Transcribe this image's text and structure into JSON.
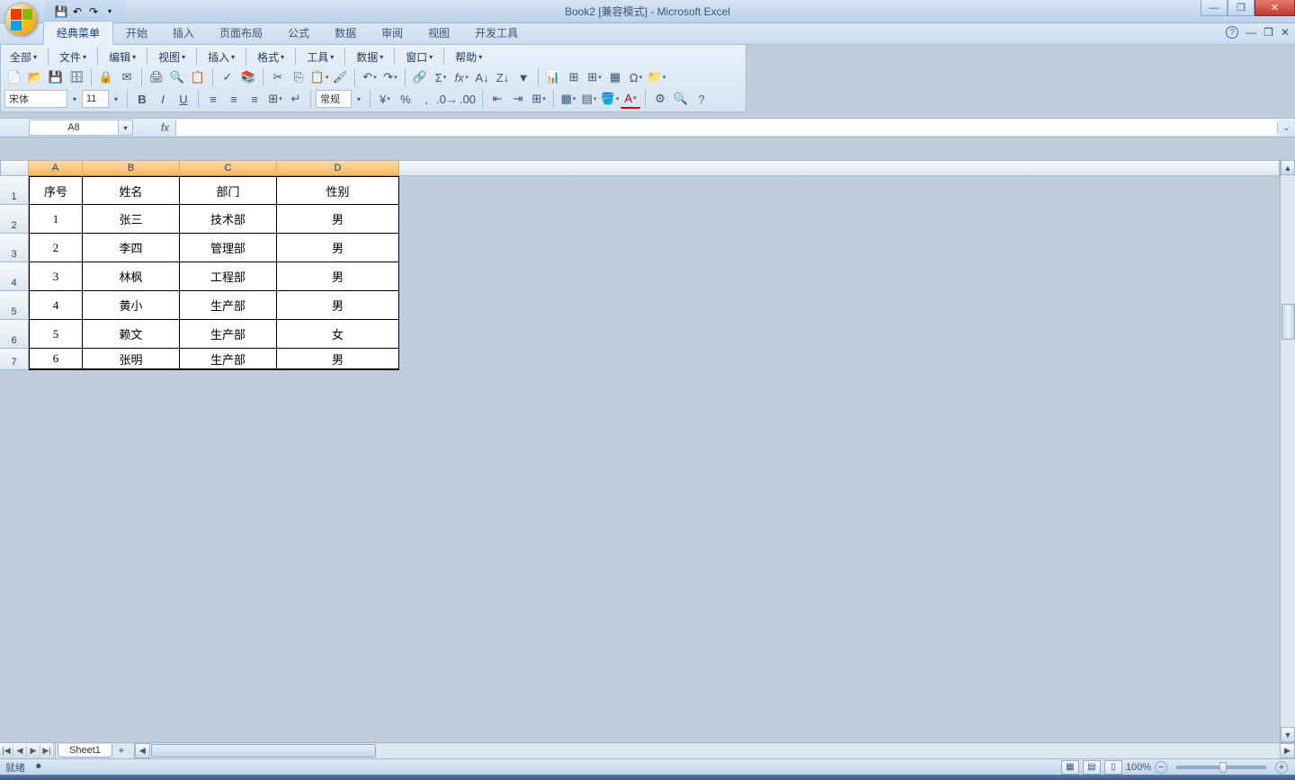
{
  "title": "Book2 [兼容模式] - Microsoft Excel",
  "ribbon": {
    "tabs": [
      "经典菜单",
      "开始",
      "插入",
      "页面布局",
      "公式",
      "数据",
      "审阅",
      "视图",
      "开发工具"
    ],
    "active": 0
  },
  "menus": [
    "全部",
    "文件",
    "编辑",
    "视图",
    "插入",
    "格式",
    "工具",
    "数据",
    "窗口",
    "帮助"
  ],
  "font": {
    "name": "宋体",
    "size": "11"
  },
  "numfmt": "常规",
  "namebox": "A8",
  "columns": [
    "A",
    "B",
    "C",
    "D"
  ],
  "table": {
    "headers": [
      "序号",
      "姓名",
      "部门",
      "性别"
    ],
    "rows": [
      [
        "1",
        "张三",
        "技术部",
        "男"
      ],
      [
        "2",
        "李四",
        "管理部",
        "男"
      ],
      [
        "3",
        "林枫",
        "工程部",
        "男"
      ],
      [
        "4",
        "黄小",
        "生产部",
        "男"
      ],
      [
        "5",
        "赖文",
        "生产部",
        "女"
      ],
      [
        "6",
        "张明",
        "生产部",
        "男"
      ]
    ]
  },
  "sheet": "Sheet1",
  "status": "就绪",
  "zoom": "100%"
}
